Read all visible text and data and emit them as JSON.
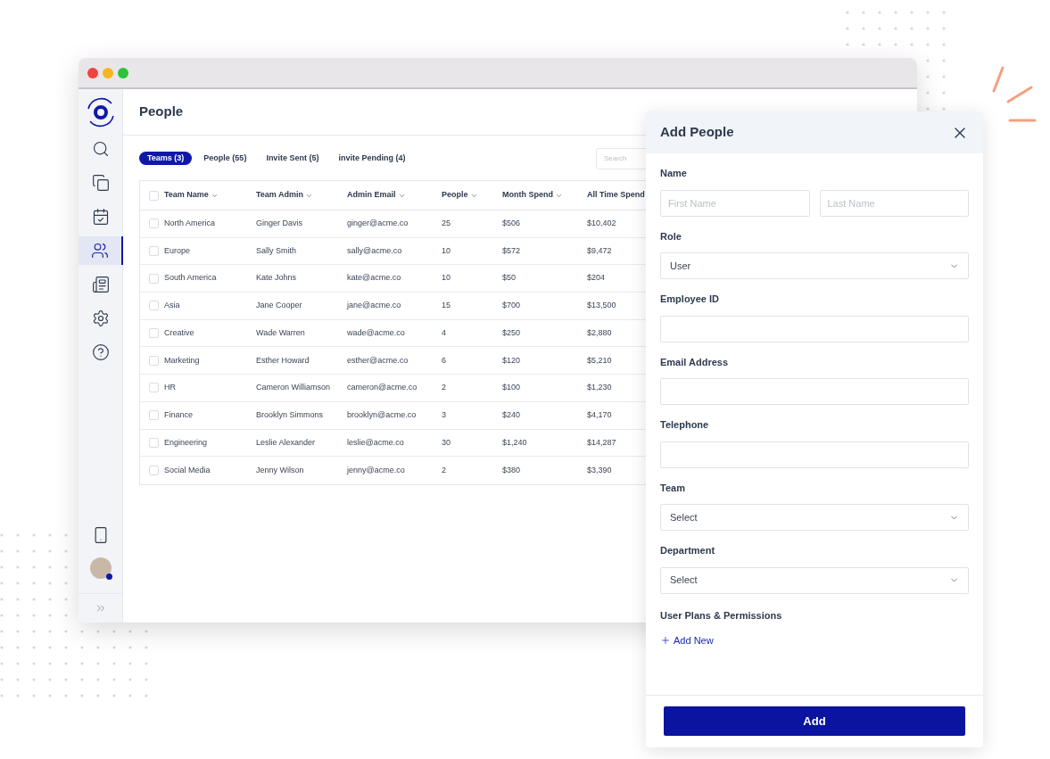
{
  "sidebar": {
    "items": [
      {
        "kind": "search",
        "selected": false
      },
      {
        "kind": "copy",
        "selected": false
      },
      {
        "kind": "calendar",
        "selected": false
      },
      {
        "kind": "team",
        "selected": true
      },
      {
        "kind": "news",
        "selected": false
      },
      {
        "kind": "settings",
        "selected": false
      },
      {
        "kind": "help",
        "selected": false
      }
    ],
    "bottom_items": [
      {
        "kind": "phone",
        "selected": false
      },
      {
        "kind": "avatar",
        "selected": false
      }
    ]
  },
  "page_title": "People",
  "tabs": [
    {
      "label": "Teams (3)",
      "selected": true
    },
    {
      "label": "People (55)",
      "selected": false
    },
    {
      "label": "Invite Sent (5)",
      "selected": false
    },
    {
      "label": "invite Pending (4)",
      "selected": false
    }
  ],
  "search": {
    "placeholder": "Search"
  },
  "table": {
    "select_all_checked": false,
    "columns": [
      {
        "label": "Team Name",
        "sortable": true
      },
      {
        "label": "Team Admin",
        "sortable": true
      },
      {
        "label": "Admin Email",
        "sortable": true
      },
      {
        "label": "People",
        "sortable": true
      },
      {
        "label": "Month Spend",
        "sortable": true
      },
      {
        "label": "All Time Spend"
      }
    ],
    "rows": [
      {
        "checked": false,
        "cells": [
          "North America",
          "Ginger Davis",
          "ginger@acme.co",
          "25",
          "$506",
          "$10,402"
        ]
      },
      {
        "checked": false,
        "cells": [
          "Europe",
          "Sally Smith",
          "sally@acme.co",
          "10",
          "$572",
          "$9,472"
        ]
      },
      {
        "checked": false,
        "cells": [
          "South America",
          "Kate Johns",
          "kate@acme.co",
          "10",
          "$50",
          "$204"
        ]
      },
      {
        "checked": false,
        "cells": [
          "Asia",
          "Jane Cooper",
          "jane@acme.co",
          "15",
          "$700",
          "$13,500"
        ]
      },
      {
        "checked": false,
        "cells": [
          "Creative",
          "Wade Warren",
          "wade@acme.co",
          "4",
          "$250",
          "$2,880"
        ]
      },
      {
        "checked": false,
        "cells": [
          "Marketing",
          "Esther Howard",
          "esther@acme.co",
          "6",
          "$120",
          "$5,210"
        ]
      },
      {
        "checked": false,
        "cells": [
          "HR",
          "Cameron Williamson",
          "cameron@acme.co",
          "2",
          "$100",
          "$1,230"
        ]
      },
      {
        "checked": false,
        "cells": [
          "Finance",
          "Brooklyn Simmons",
          "brooklyn@acme.co",
          "3",
          "$240",
          "$4,170"
        ]
      },
      {
        "checked": false,
        "cells": [
          "Engineering",
          "Leslie Alexander",
          "leslie@acme.co",
          "30",
          "$1,240",
          "$14,287"
        ]
      },
      {
        "checked": false,
        "cells": [
          "Social Media",
          "Jenny Wilson",
          "jenny@acme.co",
          "2",
          "$380",
          "$3,390"
        ]
      }
    ]
  },
  "panel": {
    "title": "Add People",
    "fields": [
      {
        "kind": "name",
        "label": "Name",
        "placeholders": [
          "First Name",
          "Last Name"
        ]
      },
      {
        "kind": "select",
        "label": "Role",
        "value": "User"
      },
      {
        "kind": "text",
        "label": "Employee ID"
      },
      {
        "kind": "text",
        "label": "Email Address"
      },
      {
        "kind": "text",
        "label": "Telephone"
      },
      {
        "kind": "select",
        "label": "Team",
        "value": "Select"
      },
      {
        "kind": "select",
        "label": "Department",
        "value": "Select"
      }
    ],
    "permissions": {
      "label": "User Plans & Permissions",
      "link": "Add New"
    },
    "submit": "Add"
  }
}
